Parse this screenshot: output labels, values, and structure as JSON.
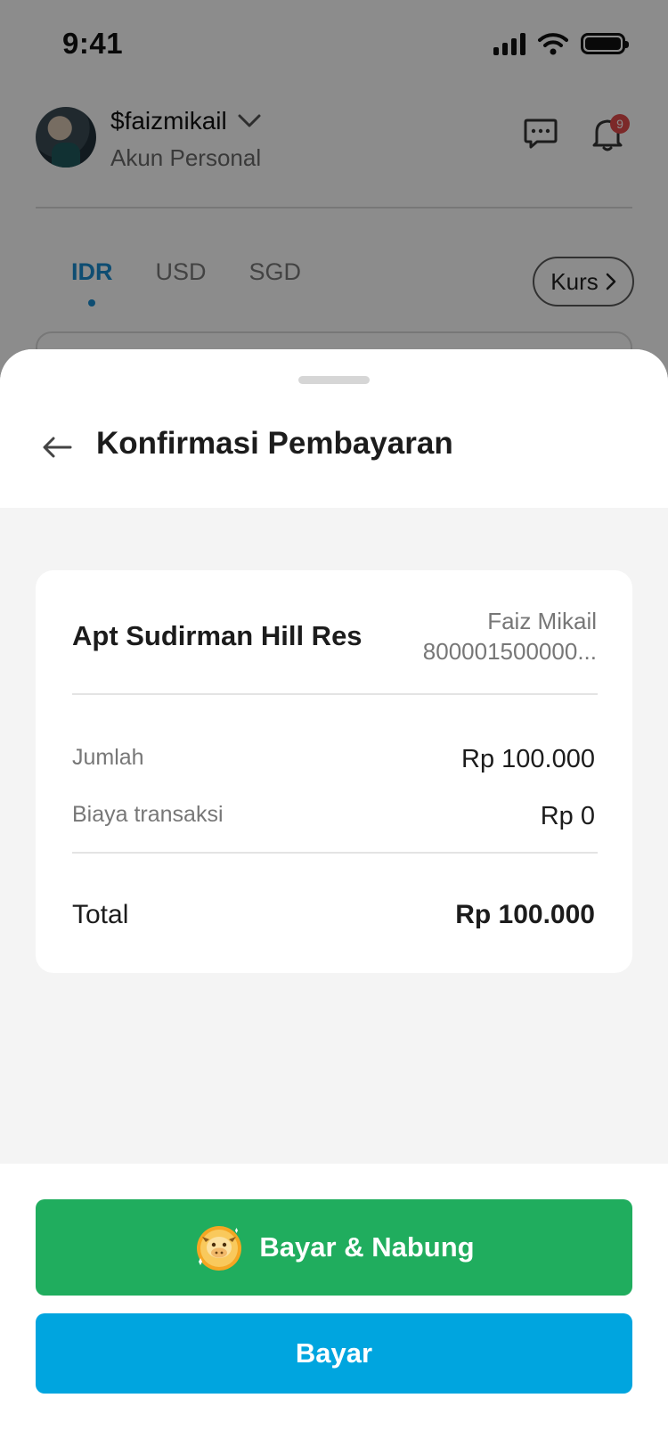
{
  "status_bar": {
    "time": "9:41"
  },
  "profile": {
    "username": "$faizmikail",
    "account_type": "Akun Personal",
    "notification_count": "9"
  },
  "currency_tabs": [
    {
      "label": "IDR",
      "active": true
    },
    {
      "label": "USD",
      "active": false
    },
    {
      "label": "SGD",
      "active": false
    }
  ],
  "kurs_button": {
    "label": "Kurs"
  },
  "sheet": {
    "title": "Konfirmasi Pembayaran",
    "biller_name": "Apt Sudirman Hill Res",
    "customer_name": "Faiz Mikail",
    "customer_number": "800001500000...",
    "rows": [
      {
        "label": "Jumlah",
        "value": "Rp 100.000"
      },
      {
        "label": "Biaya transaksi",
        "value": "Rp 0"
      }
    ],
    "total_label": "Total",
    "total_value": "Rp 100.000"
  },
  "buttons": {
    "save_and_pay": "Bayar & Nabung",
    "pay": "Bayar"
  },
  "colors": {
    "accent_blue": "#00a5df",
    "accent_green": "#20ad5e",
    "tab_active": "#1a8ccf",
    "badge_red": "#e24b4b"
  },
  "icons": [
    "signal-icon",
    "wifi-icon",
    "battery-icon",
    "chevron-down-icon",
    "chat-icon",
    "bell-icon",
    "chevron-right-icon",
    "back-arrow-icon",
    "cow-mascot-icon"
  ]
}
